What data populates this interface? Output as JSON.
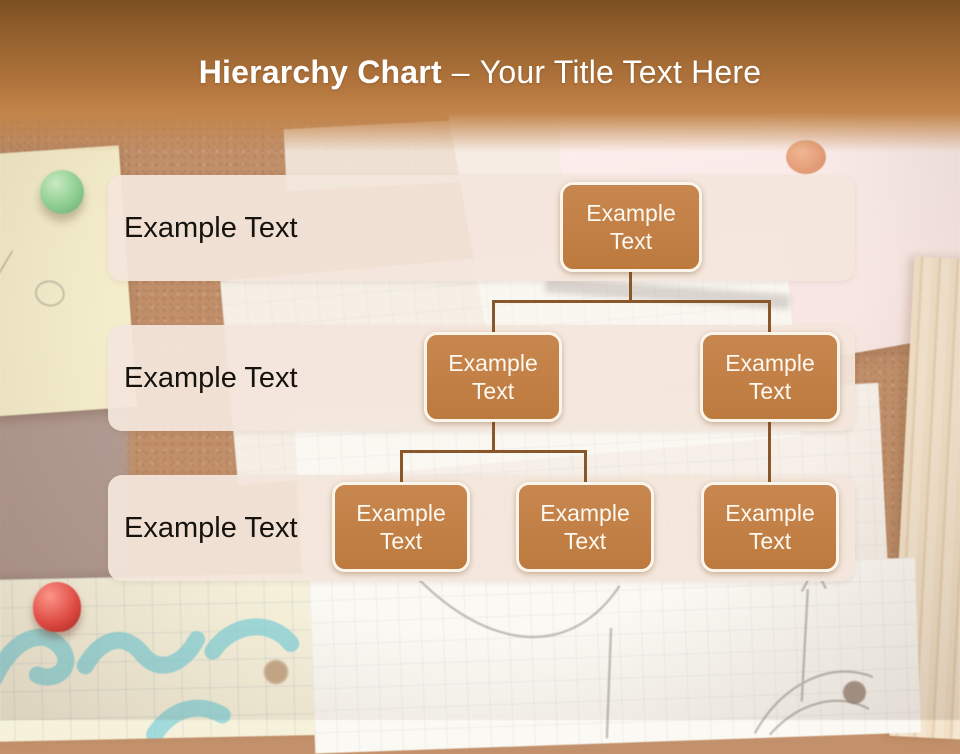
{
  "slide": {
    "title_bold": "Hierarchy Chart",
    "title_dash": "–",
    "title_rest": "Your Title Text Here"
  },
  "hierarchy": {
    "rows": [
      {
        "label": "Example Text",
        "nodes": [
          {
            "text": "Example Text"
          }
        ]
      },
      {
        "label": "Example Text",
        "nodes": [
          {
            "text": "Example Text"
          },
          {
            "text": "Example Text"
          }
        ]
      },
      {
        "label": "Example Text",
        "nodes": [
          {
            "text": "Example Text"
          },
          {
            "text": "Example Text"
          },
          {
            "text": "Example Text"
          }
        ]
      }
    ],
    "edges": [
      "root to level2-left",
      "root to level2-right",
      "level2-left to level3-a",
      "level2-left to level3-b",
      "level2-right to level3-c"
    ]
  },
  "colors": {
    "header_top": "#7b4f20",
    "header_bottom": "#c28449",
    "band": "#f3e6db",
    "node_fill": "#c17d44",
    "node_border": "#fcf5eb",
    "connector": "#8a572a",
    "title_text": "#ffffff",
    "label_text": "#16120e"
  }
}
